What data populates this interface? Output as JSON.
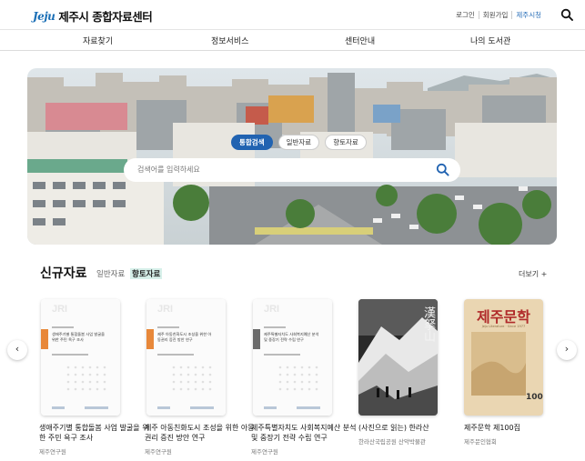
{
  "header": {
    "logo_mark": "Jeju",
    "logo_text": "제주시 종합자료센터",
    "util_links": [
      "로그인",
      "회원가입",
      "제주시청"
    ]
  },
  "nav": {
    "items": [
      "자료찾기",
      "정보서비스",
      "센터안내",
      "나의 도서관"
    ]
  },
  "hero": {
    "tabs": [
      "통합검색",
      "일반자료",
      "향토자료"
    ],
    "active_tab": 0,
    "search_placeholder": "검색어를 입력하세요"
  },
  "new_items": {
    "title": "신규자료",
    "tabs": [
      "일반자료",
      "향토자료"
    ],
    "active_tab": 1,
    "more_label": "더보기 +",
    "cover_badge": "JRI",
    "books": [
      {
        "title": "생애주기별 통합돌봄 사업 발굴을 위한 주민 욕구 조사",
        "publisher": "제주연구원",
        "cover_text": "생애주기별 통합돌봄 사업 발굴을 위한 주민 욕구 조사",
        "color": "#e8883a"
      },
      {
        "title": "제주 아동친화도시 조성을 위한 아동권리 증진 방안 연구",
        "publisher": "제주연구원",
        "cover_text": "제주 아동친화도시 조성을 위한 아동권리 증진 방안 연구",
        "color": "#e8883a"
      },
      {
        "title": "제주특별자치도 사회복지예산 분석 및 중장기 전략 수립 연구",
        "publisher": "제주연구원",
        "cover_text": "제주특별자치도 사회복지예산 분석 및 중장기 전략 수립 연구",
        "color": "#6b6b6b"
      },
      {
        "title": "(사진으로 읽는) 한라산",
        "publisher": "한라산국립공원 산악박물관",
        "cover_text": "漢拏山"
      },
      {
        "title": "제주문학 제100집",
        "publisher": "제주문인협회",
        "cover_text": "제주문학",
        "cover_sub": "Jeju Literature · Since 1977",
        "cover_num": "100"
      }
    ]
  },
  "colors": {
    "primary": "#2163b1",
    "accent_tab": "#d7f0ea"
  }
}
